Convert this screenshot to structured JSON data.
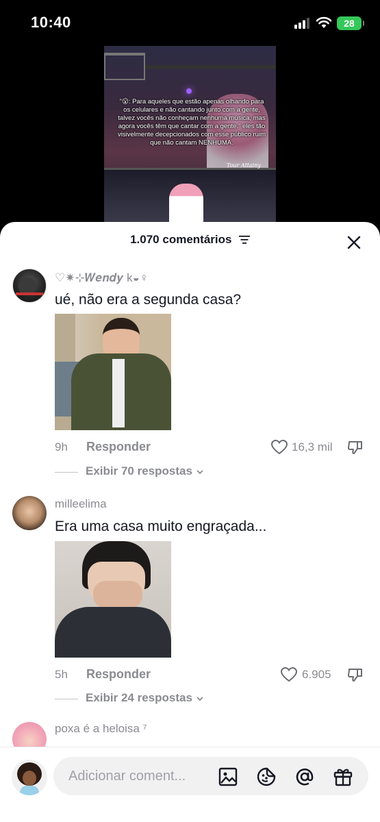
{
  "status_bar": {
    "time": "10:40",
    "battery": "28"
  },
  "video": {
    "overlay_text": "\"😮: Para aqueles que estão apenas olhando para os celulares e não cantando junto com a gente, talvez vocês não conheçam nenhuma música, mas agora vocês têm que cantar com a gente.\" eles tão visivelmente decepcionados com esse público ruim que não cantam NENHUMA.",
    "watermark": "Tour Attainy"
  },
  "comments_header": {
    "count": "1.070 comentários"
  },
  "comments": [
    {
      "username": "♡✷⊹𝑾𝒆𝒏𝒅𝒚 k◒♀",
      "text": "ué, não era a segunda casa?",
      "time": "9h",
      "reply_label": "Responder",
      "likes": "16,3 mil",
      "view_replies": "Exibir 70 respostas"
    },
    {
      "username": "milleelima",
      "text": "Era uma casa muito engraçada...",
      "time": "5h",
      "reply_label": "Responder",
      "likes": "6.905",
      "view_replies": "Exibir 24 respostas"
    },
    {
      "username": "poxa é a heloisa ⁷"
    }
  ],
  "composer": {
    "placeholder": "Adicionar coment..."
  }
}
